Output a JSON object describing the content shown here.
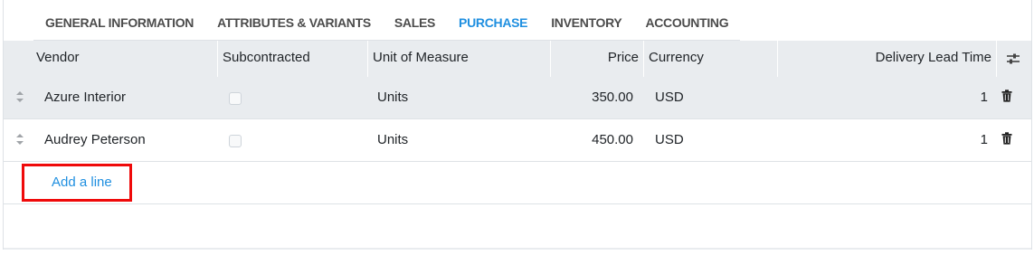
{
  "tabs": [
    {
      "label": "GENERAL INFORMATION"
    },
    {
      "label": "ATTRIBUTES & VARIANTS"
    },
    {
      "label": "SALES"
    },
    {
      "label": "PURCHASE"
    },
    {
      "label": "INVENTORY"
    },
    {
      "label": "ACCOUNTING"
    }
  ],
  "active_tab": "PURCHASE",
  "table": {
    "columns": [
      "Vendor",
      "Subcontracted",
      "Unit of Measure",
      "Price",
      "Currency",
      "Delivery Lead Time"
    ],
    "rows": [
      {
        "vendor": "Azure Interior",
        "subcontracted": false,
        "uom": "Units",
        "price": "350.00",
        "currency": "USD",
        "lead_time": "1"
      },
      {
        "vendor": "Audrey Peterson",
        "subcontracted": false,
        "uom": "Units",
        "price": "450.00",
        "currency": "USD",
        "lead_time": "1"
      }
    ],
    "add_line_label": "Add a line",
    "optional_columns_icon": "sliders-icon",
    "row_icons": {
      "handle": "drag-handle-icon",
      "delete": "trash-icon"
    }
  },
  "colors": {
    "accent": "#1f8fe0",
    "highlight": "#ef0a0a",
    "header_bg": "#e9ecef"
  }
}
